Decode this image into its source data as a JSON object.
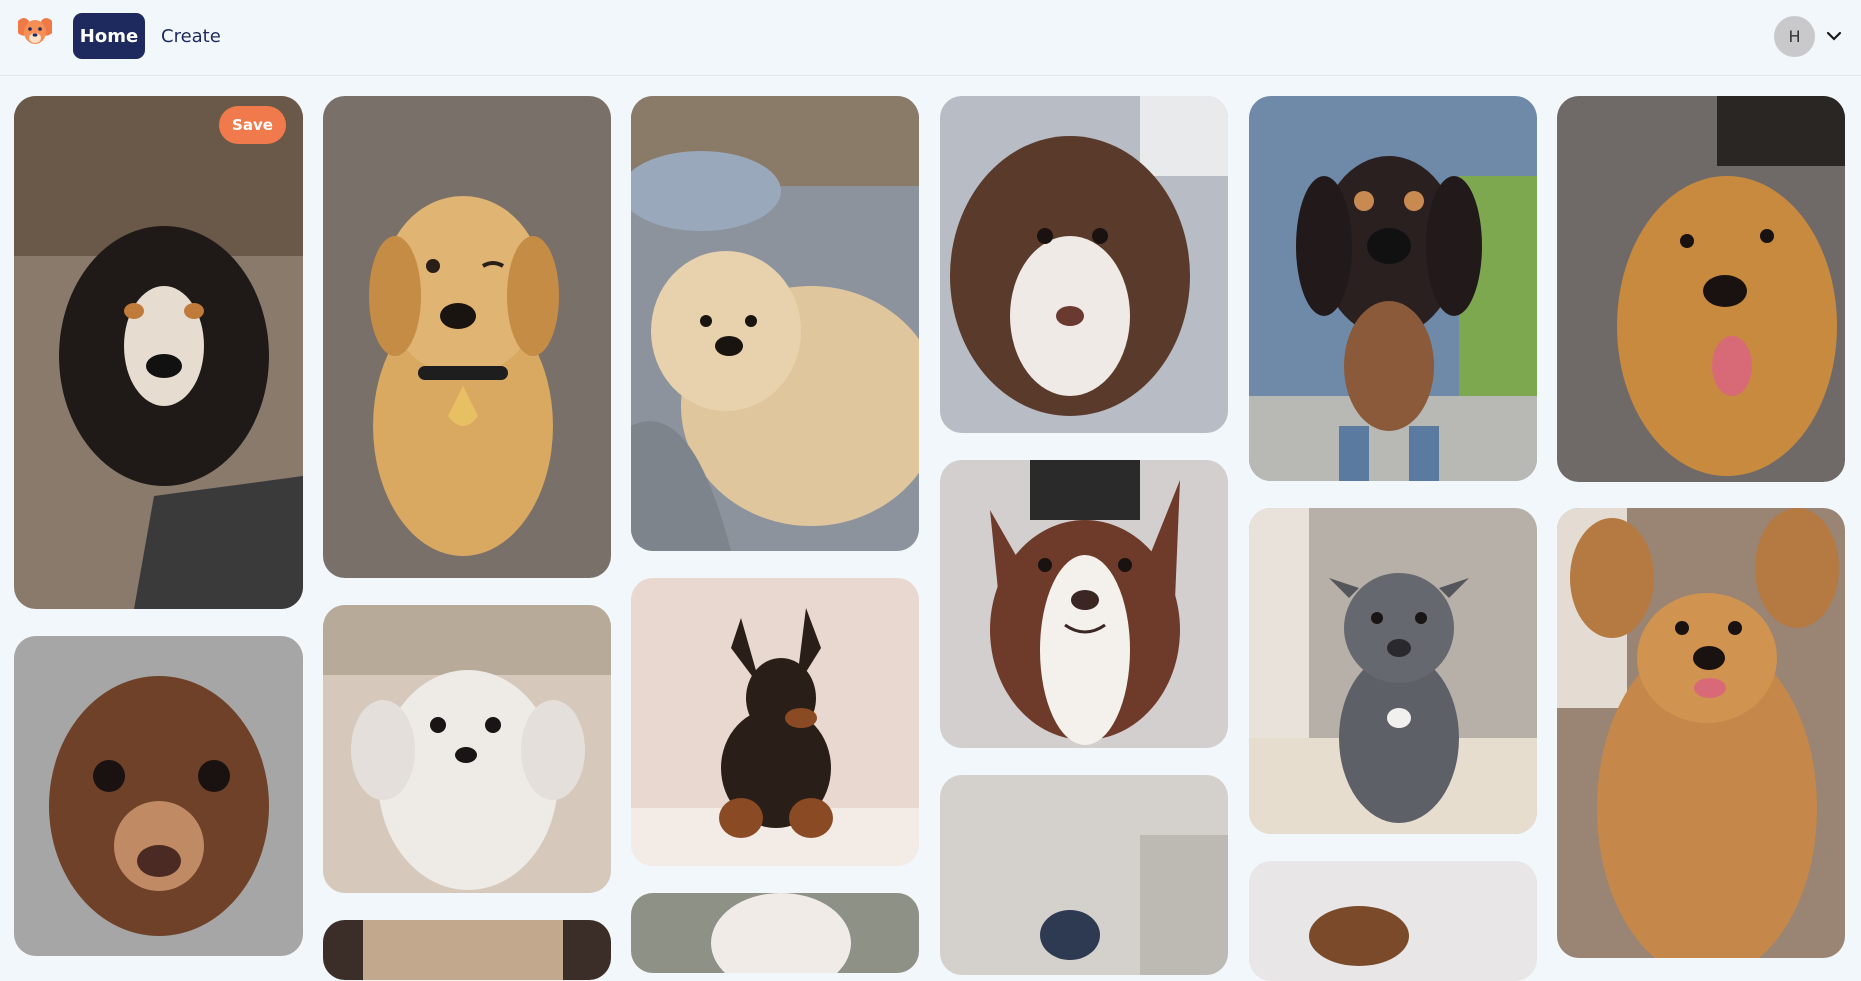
{
  "nav": {
    "home_label": "Home",
    "create_label": "Create"
  },
  "user": {
    "avatar_initial": "H"
  },
  "pin_actions": {
    "save_label": "Save"
  },
  "pins": [
    {
      "subject": "Bernese mountain dog puppy",
      "bg": "#8a7a6c",
      "fg": "#1f1a18"
    },
    {
      "subject": "Golden retriever puppy winking",
      "bg": "#7a706a",
      "fg": "#d9a861"
    },
    {
      "subject": "Golden puppy lying on couch",
      "bg": "#8d939c",
      "fg": "#e0c69c"
    },
    {
      "subject": "Brown and white shepherd puppy",
      "bg": "#b8bcc4",
      "fg": "#5a3a2a"
    },
    {
      "subject": "Dachshund held up",
      "bg": "#6e8aa8",
      "fg": "#2a2020"
    },
    {
      "subject": "Golden retriever close-up",
      "bg": "#6f6a68",
      "fg": "#c88a3e"
    },
    {
      "subject": "Dachshund puppy face",
      "bg": "#a7a6a6",
      "fg": "#6e4128"
    },
    {
      "subject": "White fluffy puppy",
      "bg": "#d6c9bb",
      "fg": "#eeeae6"
    },
    {
      "subject": "Doberman puppy",
      "bg": "#e8d8d0",
      "fg": "#2a1e18"
    },
    {
      "subject": "Smiling border collie",
      "bg": "#d2cfce",
      "fg": "#6e3a2a"
    },
    {
      "subject": "Gray pit bull puppy",
      "bg": "#b7b0a8",
      "fg": "#5e6068"
    },
    {
      "subject": "Golden dog jumping",
      "bg": "#9a8474",
      "fg": "#c6884a"
    },
    {
      "subject": "Partial pin",
      "bg": "#3b2e28",
      "fg": "#c2a88c"
    },
    {
      "subject": "Partial pin",
      "bg": "#8e9186",
      "fg": "#f1ebe8"
    },
    {
      "subject": "Partial pin",
      "bg": "#d4d1cc",
      "fg": "#2e3a52"
    },
    {
      "subject": "Partial pin",
      "bg": "#e8e6e6",
      "fg": "#7a4a2a"
    }
  ],
  "colors": {
    "brand_navy": "#1e2a5e",
    "accent_orange": "#f07a4b",
    "page_bg": "#f2f7fb"
  }
}
